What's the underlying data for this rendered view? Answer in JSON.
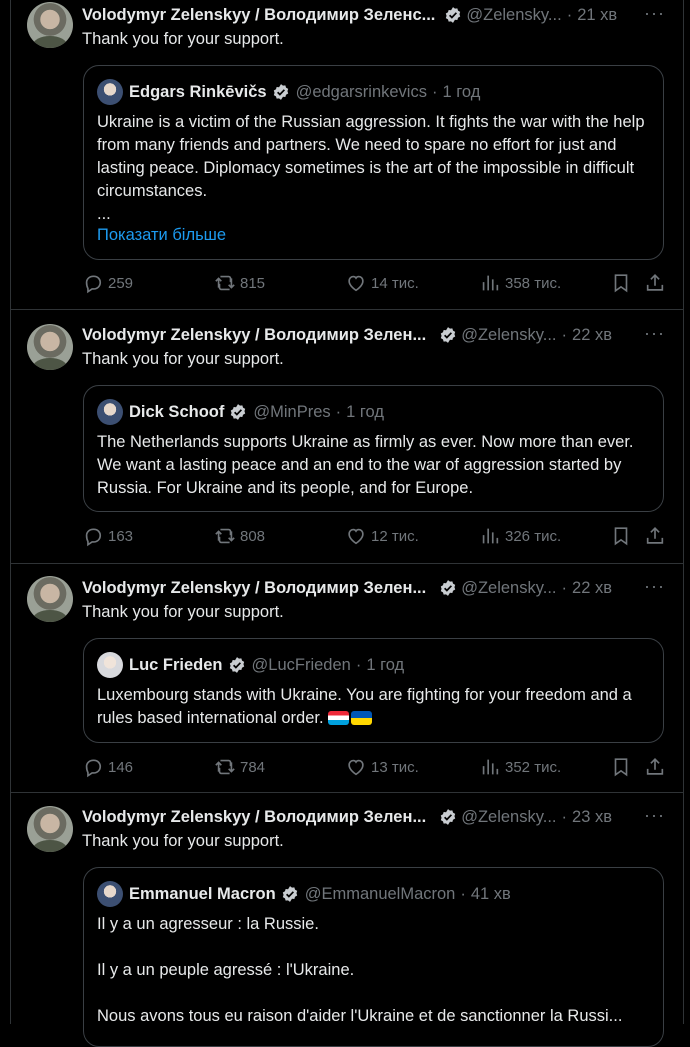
{
  "tweets": [
    {
      "author_name": "Volodymyr Zelenskyy / Володимир Зеленс...",
      "author_handle": "@Zelensky...",
      "time": "21 хв",
      "text": "Thank you for your support.",
      "quote": {
        "name": "Edgars Rinkēvičs",
        "handle": "@edgarsrinkevics",
        "time": "1 год",
        "body": "Ukraine is a victim of the Russian aggression. It fights the war with the help from many friends and partners. We need to spare no effort for just and lasting peace. Diplomacy sometimes is the art of the impossible in difficult circumstances.\n...",
        "show_more": "Показати більше"
      },
      "stats": {
        "replies": "259",
        "reposts": "815",
        "likes": "14 тис.",
        "views": "358 тис."
      }
    },
    {
      "author_name": "Volodymyr Zelenskyy / Володимир Зелен...",
      "author_handle": "@Zelensky...",
      "time": "22 хв",
      "text": "Thank you for your support.",
      "quote": {
        "name": "Dick Schoof",
        "handle": "@MinPres",
        "time": "1 год",
        "body": "The Netherlands supports Ukraine as firmly as ever. Now more than ever. We want a lasting peace and an end to the war of aggression started by Russia. For Ukraine and its people, and for Europe."
      },
      "stats": {
        "replies": "163",
        "reposts": "808",
        "likes": "12 тис.",
        "views": "326 тис."
      }
    },
    {
      "author_name": "Volodymyr Zelenskyy / Володимир Зелен...",
      "author_handle": "@Zelensky...",
      "time": "22 хв",
      "text": "Thank you for your support.",
      "quote": {
        "name": "Luc Frieden",
        "handle": "@LucFrieden",
        "time": "1 год",
        "body": "Luxembourg stands with Ukraine. You are fighting for your freedom and a rules based international order.",
        "flags": [
          "Luxembourg flag",
          "Ukraine flag"
        ]
      },
      "stats": {
        "replies": "146",
        "reposts": "784",
        "likes": "13 тис.",
        "views": "352 тис."
      }
    },
    {
      "author_name": "Volodymyr Zelenskyy / Володимир Зелен...",
      "author_handle": "@Zelensky...",
      "time": "23 хв",
      "text": "Thank you for your support.",
      "quote": {
        "name": "Emmanuel Macron",
        "handle": "@EmmanuelMacron",
        "time": "41 хв",
        "body": "Il y a un agresseur : la Russie.\n\nIl y a un peuple agressé : l'Ukraine.\n\nNous avons tous eu raison d'aider l'Ukraine et de sanctionner la Russi..."
      }
    }
  ],
  "icons": {
    "verified": "verified-badge-icon",
    "more": "more-icon",
    "reply": "reply-icon",
    "repost": "repost-icon",
    "like": "like-icon",
    "views": "views-icon",
    "bookmark": "bookmark-icon",
    "share": "share-icon"
  },
  "colors": {
    "background": "#000000",
    "text": "#e7e9ea",
    "secondary": "#71767b",
    "link": "#1d9bf0",
    "verified": "#1d9bf0"
  }
}
